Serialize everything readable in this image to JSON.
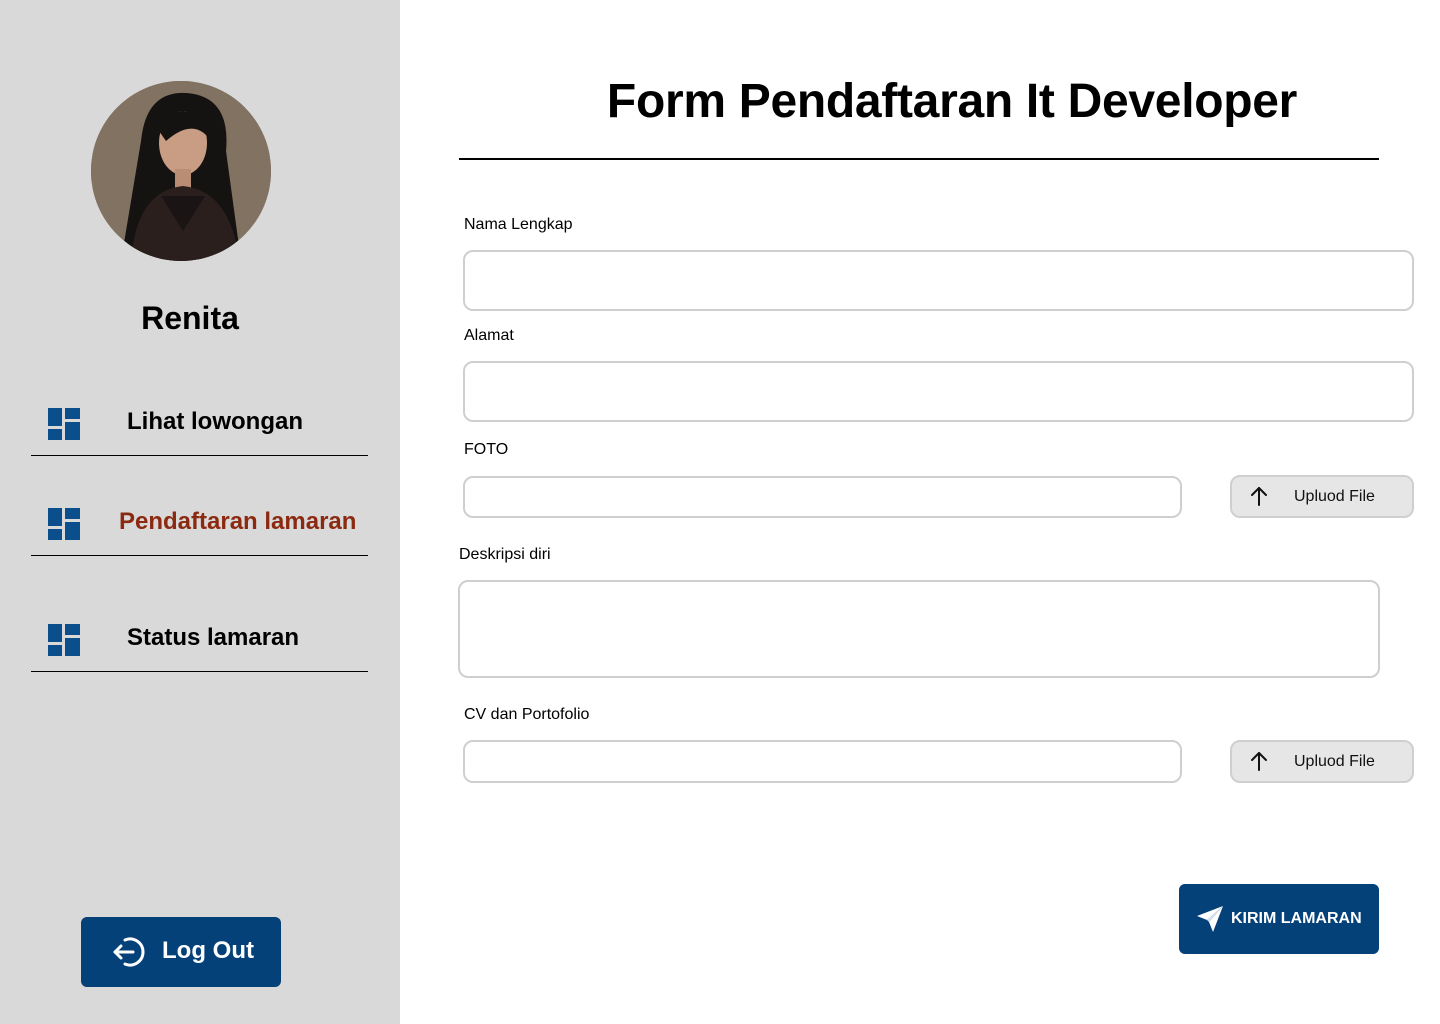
{
  "sidebar": {
    "user_name": "Renita",
    "nav_items": [
      {
        "label": "Lihat lowongan",
        "icon": "dashboard-icon",
        "active": false
      },
      {
        "label": "Pendaftaran lamaran",
        "icon": "dashboard-icon",
        "active": true
      },
      {
        "label": "Status lamaran",
        "icon": "dashboard-icon",
        "active": false
      }
    ],
    "logout_label": "Log Out"
  },
  "form": {
    "title": "Form Pendaftaran It Developer",
    "fields": {
      "nama": {
        "label": "Nama Lengkap",
        "value": ""
      },
      "alamat": {
        "label": "Alamat",
        "value": ""
      },
      "foto": {
        "label": "FOTO",
        "value": "",
        "upload_label": "Upluod File"
      },
      "deskripsi": {
        "label": "Deskripsi diri",
        "value": ""
      },
      "cv": {
        "label": "CV dan Portofolio",
        "value": "",
        "upload_label": "Upluod File"
      }
    },
    "submit_label": "KIRIM LAMARAN"
  },
  "colors": {
    "sidebar_bg": "#d9d9d9",
    "primary": "#054179",
    "active_nav": "#8b2a10"
  }
}
